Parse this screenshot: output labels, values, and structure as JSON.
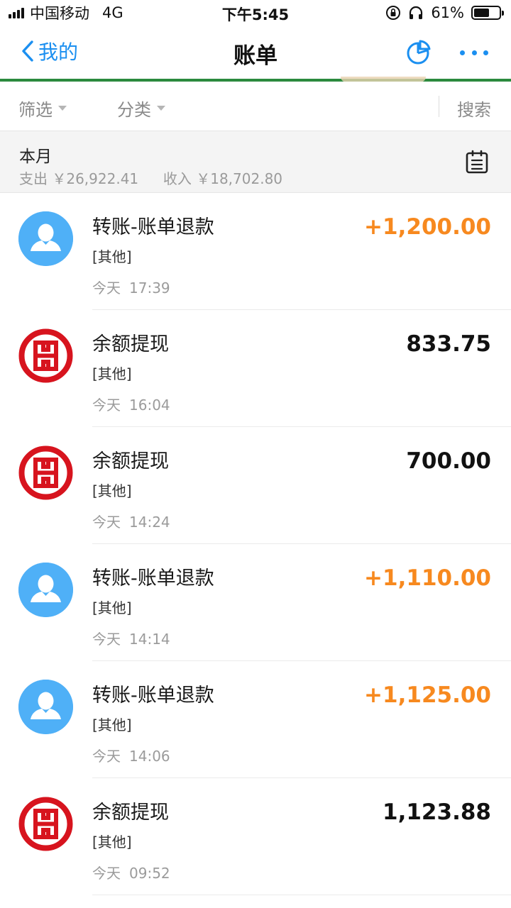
{
  "status_bar": {
    "carrier": "中国移动",
    "network": "4G",
    "time": "下午5:45",
    "battery": "61%",
    "battery_level": 0.61
  },
  "nav": {
    "back_label": "我的",
    "title": "账单"
  },
  "filters": {
    "filter_label": "筛选",
    "category_label": "分类",
    "search_label": "搜索"
  },
  "month": {
    "title": "本月",
    "expense_label": "支出",
    "expense": "￥26,922.41",
    "income_label": "收入",
    "income": "￥18,702.80"
  },
  "colors": {
    "accent": "#1b8ff0",
    "income": "#f7891f",
    "bank_red": "#d7141e",
    "avatar_blue": "#4fb0f7"
  },
  "transactions": [
    {
      "icon": "person-avatar-icon",
      "title": "转账-账单退款",
      "category": "[其他]",
      "day": "今天",
      "time": "17:39",
      "amount": "+1,200.00",
      "type": "income"
    },
    {
      "icon": "icbc-bank-icon",
      "title": "余额提现",
      "category": "[其他]",
      "day": "今天",
      "time": "16:04",
      "amount": "833.75",
      "type": "neutral"
    },
    {
      "icon": "icbc-bank-icon",
      "title": "余额提现",
      "category": "[其他]",
      "day": "今天",
      "time": "14:24",
      "amount": "700.00",
      "type": "neutral"
    },
    {
      "icon": "person-avatar-icon",
      "title": "转账-账单退款",
      "category": "[其他]",
      "day": "今天",
      "time": "14:14",
      "amount": "+1,110.00",
      "type": "income"
    },
    {
      "icon": "person-avatar-icon",
      "title": "转账-账单退款",
      "category": "[其他]",
      "day": "今天",
      "time": "14:06",
      "amount": "+1,125.00",
      "type": "income"
    },
    {
      "icon": "icbc-bank-icon",
      "title": "余额提现",
      "category": "[其他]",
      "day": "今天",
      "time": "09:52",
      "amount": "1,123.88",
      "type": "neutral"
    }
  ]
}
